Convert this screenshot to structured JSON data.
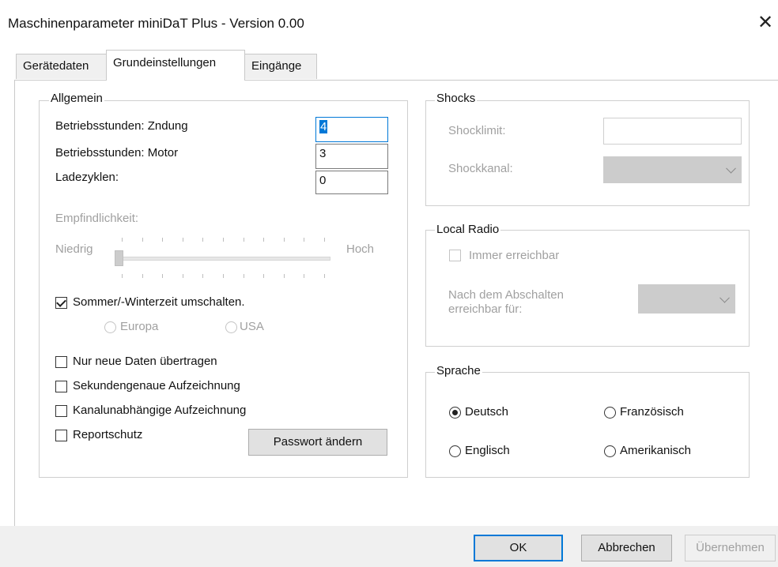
{
  "window": {
    "title": "Maschinenparameter miniDaT Plus - Version 0.00",
    "close_glyph": "✕"
  },
  "tabs": [
    "Gerätedaten",
    "Grundeinstellungen",
    "Eingänge"
  ],
  "active_tab": "Grundeinstellungen",
  "allgemein": {
    "legend": "Allgemein",
    "fields": [
      {
        "label": "Betriebsstunden: Zndung",
        "value": "4"
      },
      {
        "label": "Betriebsstunden: Motor",
        "value": "3"
      },
      {
        "label": "Ladezyklen:",
        "value": "0"
      }
    ],
    "sensitivity": {
      "label": "Empfindlichkeit:",
      "low": "Niedrig",
      "high": "Hoch",
      "level_fraction": 0,
      "enabled": false
    },
    "dst": {
      "label": "Sommer/-Winterzeit umschalten.",
      "checked": true,
      "options": [
        "Europa",
        "USA"
      ]
    },
    "checkboxes": [
      {
        "label": "Nur neue Daten übertragen",
        "checked": false
      },
      {
        "label": "Sekundengenaue Aufzeichnung",
        "checked": false
      },
      {
        "label": "Kanalunabhängige Aufzeichnung",
        "checked": false
      },
      {
        "label": "Reportschutz",
        "checked": false
      }
    ],
    "password_button": "Passwort ändern"
  },
  "shocks": {
    "legend": "Shocks",
    "limit_label": "Shocklimit:",
    "limit_value": "",
    "channel_label": "Shockkanal:",
    "channel_value": ""
  },
  "local_radio": {
    "legend": "Local Radio",
    "always_label": "Immer erreichbar",
    "always_checked": false,
    "after_label_line1": "Nach dem Abschalten",
    "after_label_line2": "erreichbar für:",
    "after_value": ""
  },
  "sprache": {
    "legend": "Sprache",
    "options": [
      "Deutsch",
      "Französisch",
      "Englisch",
      "Amerikanisch"
    ],
    "selected": "Deutsch"
  },
  "buttons": {
    "ok": "OK",
    "cancel": "Abbrechen",
    "apply": "Übernehmen"
  }
}
